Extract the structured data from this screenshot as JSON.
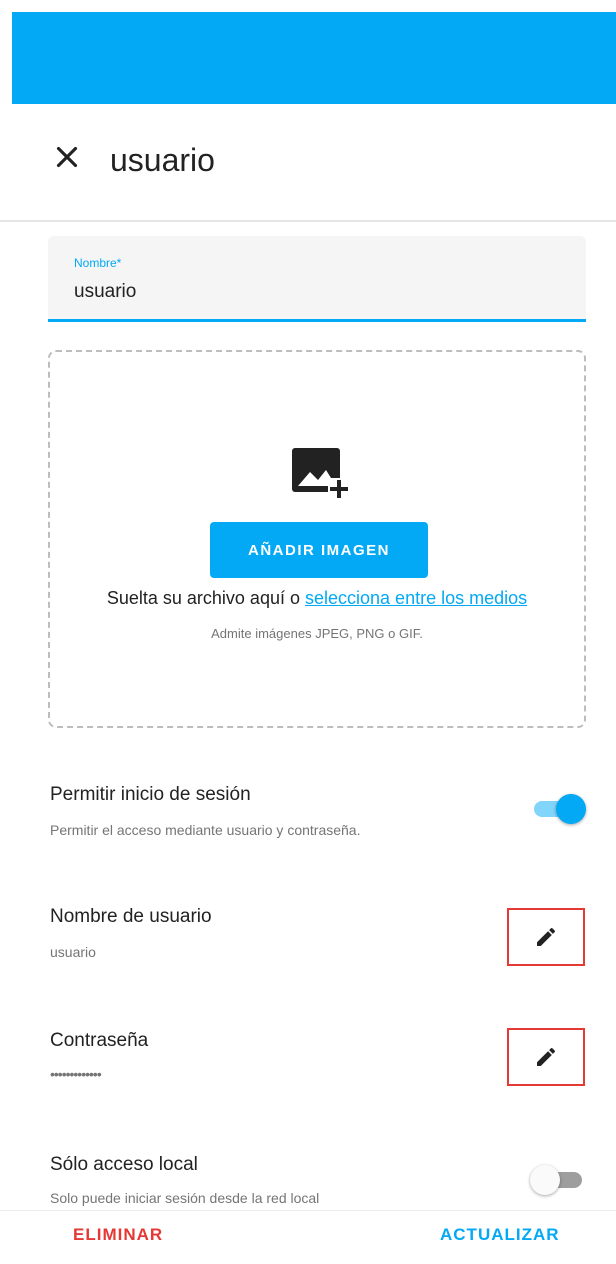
{
  "colors": {
    "accent": "#03a9f4",
    "danger": "#e53935"
  },
  "dialog": {
    "title": "usuario",
    "close_icon": "close-icon"
  },
  "name_field": {
    "label": "Nombre*",
    "value": "usuario"
  },
  "image_upload": {
    "icon": "add-photo-icon",
    "button_label": "AÑADIR IMAGEN",
    "drop_text": "Suelta su archivo aquí o",
    "media_link": "selecciona entre los medios",
    "hint": "Admite imágenes JPEG, PNG o GIF."
  },
  "settings": {
    "allow_login": {
      "title": "Permitir inicio de sesión",
      "subtitle": "Permitir el acceso mediante usuario y contraseña.",
      "enabled": true
    },
    "username": {
      "title": "Nombre de usuario",
      "value": "usuario",
      "edit_icon": "pencil-icon"
    },
    "password": {
      "title": "Contraseña",
      "value": "•••••••••••••",
      "edit_icon": "pencil-icon"
    },
    "local_only": {
      "title": "Sólo acceso local",
      "subtitle": "Solo puede iniciar sesión desde la red local",
      "enabled": false
    }
  },
  "footer": {
    "delete_label": "ELIMINAR",
    "update_label": "ACTUALIZAR"
  }
}
